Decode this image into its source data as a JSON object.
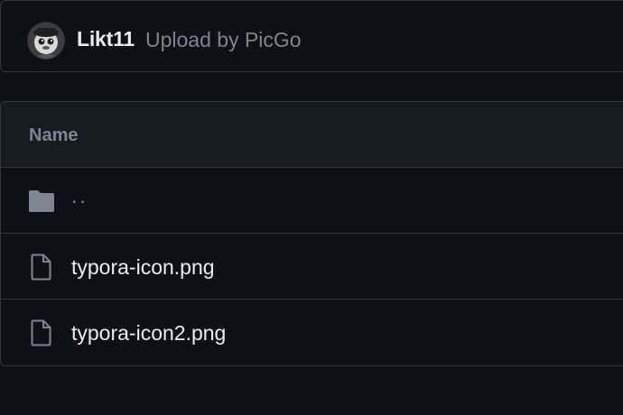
{
  "commit": {
    "author": "Likt11",
    "message": "Upload by PicGo",
    "avatar_icon": "avatar-image"
  },
  "table": {
    "header": "Name",
    "rows": [
      {
        "name": "..",
        "icon": "folder-icon",
        "type": "parent-directory"
      },
      {
        "name": "typora-icon.png",
        "icon": "file-icon",
        "type": "file"
      },
      {
        "name": "typora-icon2.png",
        "icon": "file-icon",
        "type": "file"
      }
    ]
  },
  "colors": {
    "background": "#0d1117",
    "header_background": "#161b22",
    "border": "#30363d",
    "text_primary": "#e6edf3",
    "text_muted": "#7d8590"
  }
}
